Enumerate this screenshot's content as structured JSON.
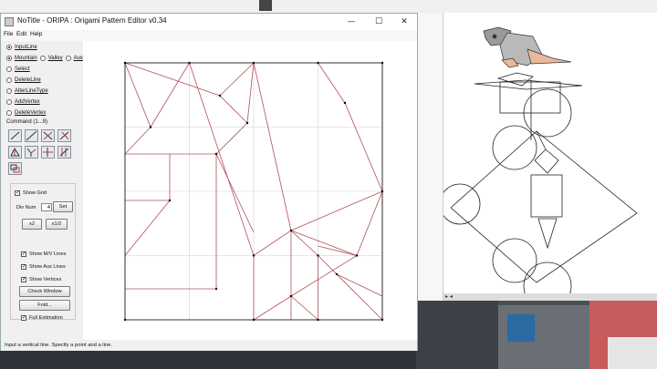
{
  "window": {
    "title": "NoTitle - ORIPA : Origami Pattern Editor  v0.34",
    "minimize_glyph": "—",
    "maximize_glyph": "☐",
    "close_glyph": "✕"
  },
  "menu": [
    "File",
    "Edit",
    "Help"
  ],
  "mode_radios": [
    {
      "label": "InputLine",
      "selected": true
    },
    {
      "label": "Select",
      "selected": false
    },
    {
      "label": "DeleteLine",
      "selected": false
    },
    {
      "label": "AlterLineType",
      "selected": false
    },
    {
      "label": "AddVertex",
      "selected": false
    },
    {
      "label": "DeleteVertex",
      "selected": false
    }
  ],
  "line_type": [
    {
      "label": "Mountain",
      "selected": true
    },
    {
      "label": "Valley",
      "selected": false
    },
    {
      "label": "Aux",
      "selected": false
    }
  ],
  "command_label": "Command (1...9)",
  "tools": [
    "segment-tool",
    "line-tool",
    "bisector-tool",
    "perpendicular-tool",
    "triangle-tool",
    "symmetric-tool",
    "mirror-tool",
    "pbisector-tool",
    "copy-paste-tool"
  ],
  "grid": {
    "show_grid_label": "Show Grid",
    "show_grid": true,
    "div_num_label": "Div Num",
    "div_num_value": "4",
    "set_label": "Set",
    "x2_label": "x2",
    "half_label": "x1/2"
  },
  "display_options": [
    {
      "label": "Show M/V Lines",
      "checked": true
    },
    {
      "label": "Show Aux Lines",
      "checked": true
    },
    {
      "label": "Show Vertices",
      "checked": true
    }
  ],
  "actions": {
    "check_window": "Check Window",
    "fold": "Fold...",
    "full_estimation": "Full Estimation",
    "full_estimation_checked": true
  },
  "status": "Input a vertical line. Specify a point and a line.",
  "doc_status": "▸  ◂",
  "colors": {
    "mountain": "#b0505a",
    "grid": "#c8c8c8",
    "border": "#000000",
    "vertex": "#000000"
  }
}
